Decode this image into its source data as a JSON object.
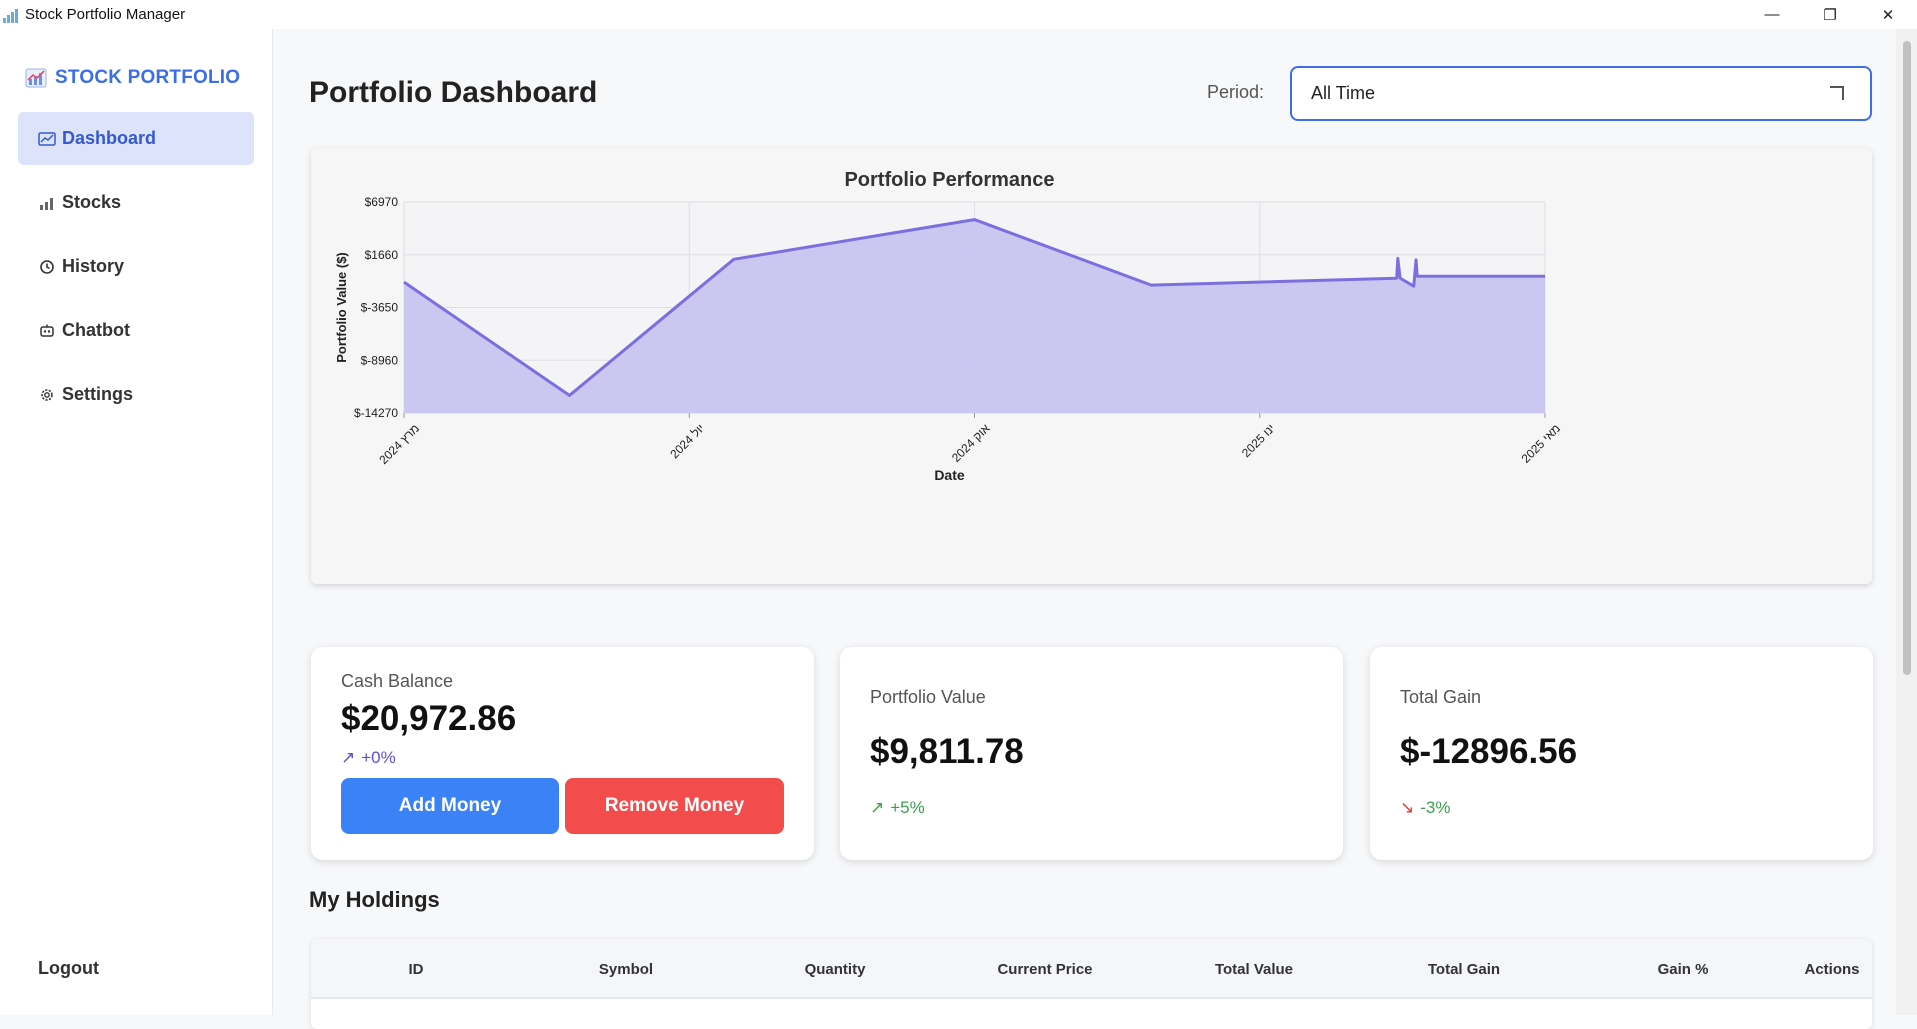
{
  "window": {
    "title": "Stock Portfolio Manager",
    "minimize_glyph": "—",
    "restore_glyph": "❐",
    "close_glyph": "✕"
  },
  "sidebar": {
    "brand": "STOCK PORTFOLIO",
    "items": [
      {
        "label": "Dashboard",
        "icon": "chart-line-icon",
        "active": true
      },
      {
        "label": "Stocks",
        "icon": "bar-chart-icon",
        "active": false
      },
      {
        "label": "History",
        "icon": "history-icon",
        "active": false
      },
      {
        "label": "Chatbot",
        "icon": "robot-icon",
        "active": false
      },
      {
        "label": "Settings",
        "icon": "gear-icon",
        "active": false
      }
    ],
    "logout": "Logout"
  },
  "header": {
    "title": "Portfolio Dashboard",
    "period_label": "Period:",
    "period_value": "All Time"
  },
  "chart_data": {
    "type": "area",
    "title": "Portfolio Performance",
    "xlabel": "Date",
    "ylabel": "Portfolio Value ($)",
    "y_ticks": [
      "$6970",
      "$1660",
      "$-3650",
      "$-8960",
      "$-14270"
    ],
    "ylim": [
      -14270,
      6970
    ],
    "x_ticks": [
      "מרץ 2024",
      "יול 2024",
      "אוק 2024",
      "ינו 2025",
      "מאי 2025"
    ],
    "grid": true,
    "color": "#7b6fe0",
    "fill": "#c5c3f1",
    "x": [
      0.0,
      0.145,
      0.289,
      0.5,
      0.655,
      0.87,
      0.871,
      0.873,
      0.885,
      0.887,
      0.888,
      1.0
    ],
    "values": [
      -1100,
      -12500,
      1200,
      5200,
      -1400,
      -700,
      1300,
      -700,
      -1500,
      1150,
      -500,
      -500
    ]
  },
  "cards": {
    "cash": {
      "label": "Cash Balance",
      "value": "$20,972.86",
      "change": "+0%",
      "arrow": "↗",
      "change_color": "#5b4fd6",
      "add_label": "Add Money",
      "remove_label": "Remove Money"
    },
    "portfolio": {
      "label": "Portfolio Value",
      "value": "$9,811.78",
      "change": "+5%",
      "arrow": "↗",
      "change_color": "#3aa04f"
    },
    "gain": {
      "label": "Total Gain",
      "value": "$-12896.56",
      "change": "-3%",
      "arrow": "↘",
      "arrow_color": "#e53935",
      "change_color": "#3aa04f"
    }
  },
  "holdings": {
    "title": "My Holdings",
    "columns": [
      "ID",
      "Symbol",
      "Quantity",
      "Current Price",
      "Total Value",
      "Total Gain",
      "Gain %",
      "Actions"
    ]
  }
}
